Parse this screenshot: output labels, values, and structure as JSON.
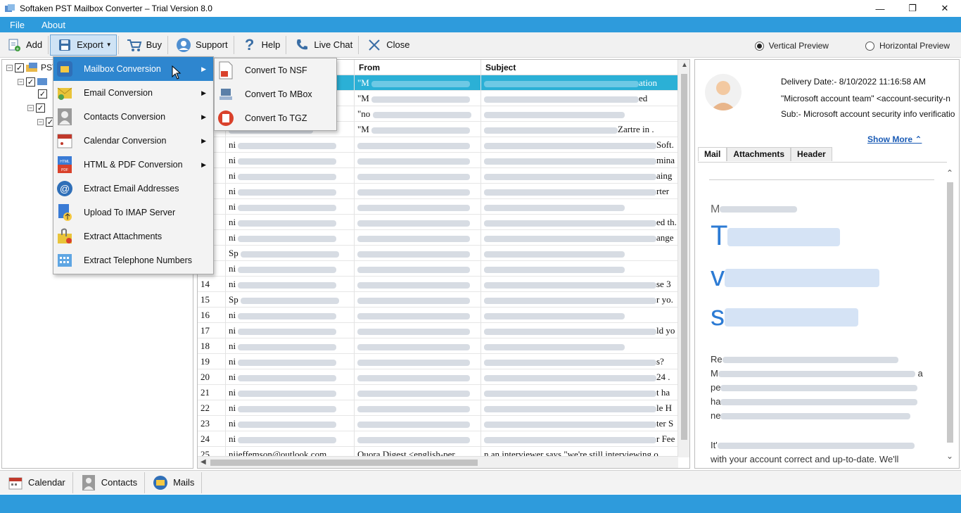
{
  "window": {
    "title": "Softaken PST Mailbox Converter – Trial Version 8.0",
    "minimize": "—",
    "maximize": "❐",
    "close": "✕"
  },
  "menubar": {
    "items": [
      "File",
      "About"
    ]
  },
  "toolbar": {
    "add": "Add",
    "export": "Export",
    "buy": "Buy",
    "support": "Support",
    "help": "Help",
    "live_chat": "Live Chat",
    "close": "Close"
  },
  "preview_options": {
    "vertical": "Vertical Preview",
    "horizontal": "Horizontal Preview",
    "selected": "vertical"
  },
  "tree": {
    "root_label": "PST"
  },
  "grid": {
    "columns": [
      "From",
      "Subject"
    ],
    "row_numbers": [
      "14",
      "15",
      "16",
      "17",
      "18",
      "19",
      "20",
      "21",
      "22",
      "23",
      "24",
      "25"
    ],
    "visible_fragments": {
      "row1_subject_tail": "ation",
      "row2_subject_tail": "ed",
      "row4_subject_tail": "Zartre in .",
      "row5_tail": "Soft.",
      "row6_tail": "mina",
      "row7_tail": "aing",
      "row8_tail": "rter",
      "row10_tail": "ed th.",
      "row11_tail": "ange",
      "row14_tail": "se 3",
      "row15_tail": "r yo.",
      "row17_tail": "ld yo",
      "row19_tail": "s?",
      "row20_tail": "24 .",
      "row21_tail": "t ha",
      "row22_tail": "le H",
      "row23_tail": "ter S",
      "row24_tail": "r Fee",
      "row25_from": "nijeffemson@outlook.com",
      "row25_sender": "Quora Digest <english-per...",
      "row25_subject": "n an interviewer says \"we're still interviewing o",
      "row1_from": "\"M",
      "row2_from": "\"M",
      "row3_from": "\"no",
      "row4_from": "\"M",
      "row_prefix_ni": "ni",
      "row_prefix_sp": "Sp"
    }
  },
  "preview": {
    "delivery_date": "Delivery Date:- 8/10/2022 11:16:58 AM",
    "from": "\"Microsoft account team\" <account-security-n",
    "subject": "Sub:- Microsoft account security info verificatio",
    "show_more": "Show More ⌃",
    "tabs": [
      "Mail",
      "Attachments",
      "Header"
    ],
    "body_letters": [
      "M",
      "T",
      "v",
      "s",
      "Re",
      "M",
      "pe",
      "ha",
      "ne",
      "It'",
      "with your account correct and up-to-date. We'll"
    ]
  },
  "export_menu": {
    "items": [
      "Mailbox Conversion",
      "Email Conversion",
      "Contacts Conversion",
      "Calendar Conversion",
      "HTML & PDF Conversion",
      "Extract Email Addresses",
      "Upload To IMAP Server",
      "Extract Attachments",
      "Extract Telephone Numbers"
    ],
    "highlighted": "Mailbox Conversion"
  },
  "submenu": {
    "items": [
      "Convert To NSF",
      "Convert To MBox",
      "Convert To TGZ"
    ]
  },
  "bottom_tabs": [
    "Calendar",
    "Contacts",
    "Mails"
  ],
  "colors": {
    "accent_blue": "#2e9bdc",
    "selection": "#2bb0d6",
    "menu_highlight": "#2e86cf",
    "link": "#1a5bb5"
  }
}
